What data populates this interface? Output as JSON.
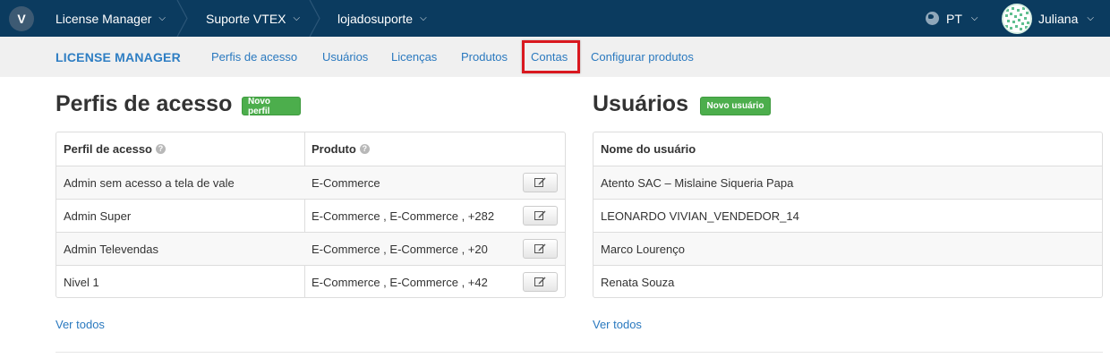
{
  "topbar": {
    "logo_letter": "V",
    "breadcrumbs": [
      "License Manager",
      "Suporte VTEX",
      "lojadosuporte"
    ],
    "language": "PT",
    "user_name": "Juliana"
  },
  "subnav": {
    "brand": "LICENSE MANAGER",
    "links": [
      "Perfis de acesso",
      "Usuários",
      "Licenças",
      "Produtos",
      "Contas",
      "Configurar produtos"
    ]
  },
  "profiles": {
    "title": "Perfis de acesso",
    "new_button": "Novo perfil",
    "columns": [
      "Perfil de acesso",
      "Produto"
    ],
    "rows": [
      {
        "profile": "Admin sem acesso a tela de vale",
        "product": "E-Commerce"
      },
      {
        "profile": "Admin Super",
        "product": "E-Commerce , E-Commerce , +282"
      },
      {
        "profile": "Admin Televendas",
        "product": "E-Commerce , E-Commerce , +20"
      },
      {
        "profile": "Nivel 1",
        "product": "E-Commerce , E-Commerce , +42"
      }
    ],
    "see_all": "Ver todos"
  },
  "users": {
    "title": "Usuários",
    "new_button": "Novo usuário",
    "column": "Nome do usuário",
    "rows": [
      "Atento SAC – Mislaine Siqueria Papa",
      "LEONARDO VIVIAN_VENDEDOR_14",
      "Marco Lourenço",
      "Renata Souza"
    ],
    "see_all": "Ver todos"
  },
  "colors": {
    "topbar": "#0b3b5f",
    "link": "#2a79bf",
    "green": "#4cae4c",
    "highlight": "#d9181f"
  }
}
